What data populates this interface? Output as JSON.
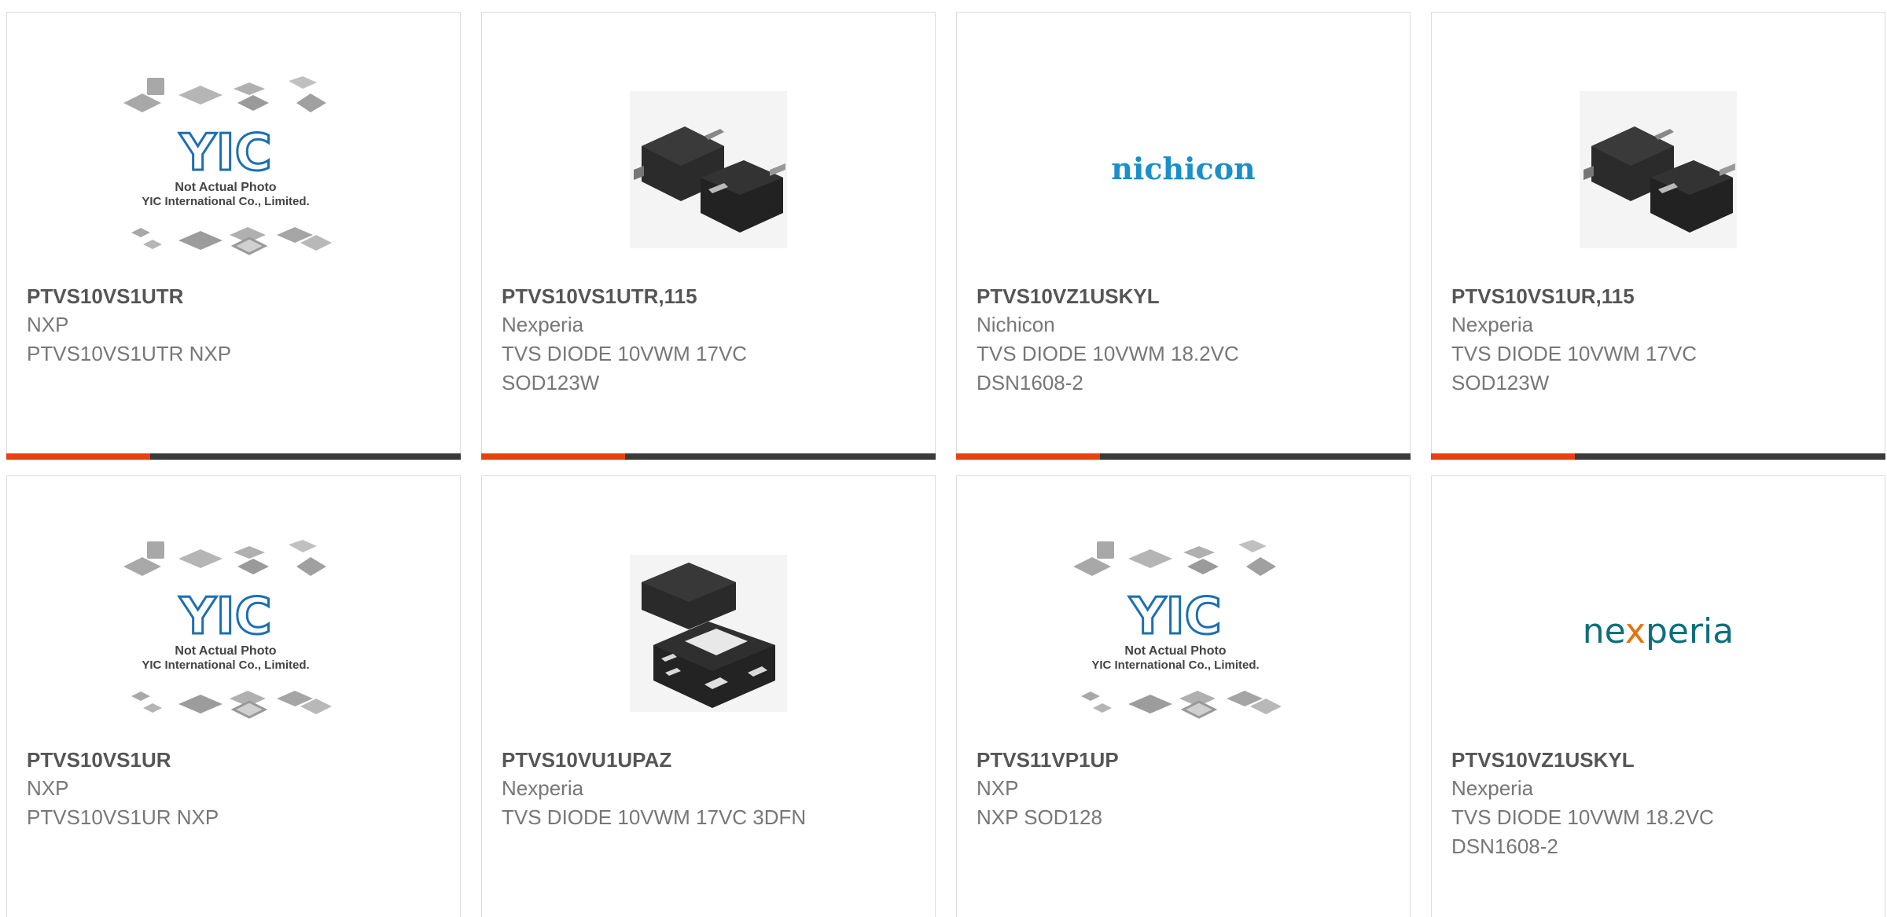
{
  "colors": {
    "accent": "#e8410f",
    "bar": "#3a3a3a",
    "border": "#dcdcdc",
    "part_number": "#555555",
    "text": "#777777",
    "yic_blue": "#1b6fb3",
    "nichicon_blue": "#1a8fc9",
    "nexperia_teal": "#0e6f7c",
    "nexperia_orange": "#e8710a"
  },
  "placeholder": {
    "brand": "YIC",
    "line1": "Not Actual Photo",
    "line2": "YIC International Co., Limited."
  },
  "logos": {
    "nichicon": "nichicon",
    "nexperia_a": "ne",
    "nexperia_x": "x",
    "nexperia_b": "peria"
  },
  "products": [
    {
      "part_number": "PTVS10VS1UTR",
      "manufacturer": "NXP",
      "description_lines": [
        "PTVS10VS1UTR NXP"
      ],
      "image": "yic-placeholder"
    },
    {
      "part_number": "PTVS10VS1UTR,115",
      "manufacturer": "Nexperia",
      "description_lines": [
        "TVS DIODE 10VWM 17VC",
        "SOD123W"
      ],
      "image": "sod123w-package"
    },
    {
      "part_number": "PTVS10VZ1USKYL",
      "manufacturer": "Nichicon",
      "description_lines": [
        "TVS DIODE 10VWM 18.2VC",
        "DSN1608-2"
      ],
      "image": "nichicon-logo"
    },
    {
      "part_number": "PTVS10VS1UR,115",
      "manufacturer": "Nexperia",
      "description_lines": [
        "TVS DIODE 10VWM 17VC",
        "SOD123W"
      ],
      "image": "sod123w-package"
    },
    {
      "part_number": "PTVS10VS1UR",
      "manufacturer": "NXP",
      "description_lines": [
        "PTVS10VS1UR NXP"
      ],
      "image": "yic-placeholder"
    },
    {
      "part_number": "PTVS10VU1UPAZ",
      "manufacturer": "Nexperia",
      "description_lines": [
        "TVS DIODE 10VWM 17VC 3DFN"
      ],
      "image": "dfn-package"
    },
    {
      "part_number": "PTVS11VP1UP",
      "manufacturer": "NXP",
      "description_lines": [
        "NXP SOD128"
      ],
      "image": "yic-placeholder"
    },
    {
      "part_number": "PTVS10VZ1USKYL",
      "manufacturer": "Nexperia",
      "description_lines": [
        "TVS DIODE 10VWM 18.2VC",
        "DSN1608-2"
      ],
      "image": "nexperia-logo"
    }
  ]
}
